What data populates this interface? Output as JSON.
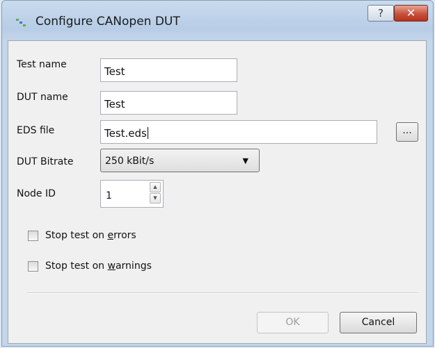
{
  "window": {
    "title": "Configure CANopen DUT",
    "help_label": "?",
    "close_label": "✕"
  },
  "form": {
    "test_name": {
      "label": "Test name",
      "value": "Test"
    },
    "dut_name": {
      "label": "DUT name",
      "value": "Test"
    },
    "eds_file": {
      "label": "EDS file",
      "value": "Test.eds",
      "browse_label": "..."
    },
    "dut_bitrate": {
      "label": "DUT Bitrate",
      "selected": "250 kBit/s"
    },
    "node_id": {
      "label": "Node ID",
      "value": "1"
    }
  },
  "options": {
    "stop_on_errors": {
      "label_prefix": "Stop test on ",
      "label_access": "e",
      "label_suffix": "rrors",
      "checked": false
    },
    "stop_on_warnings": {
      "label_prefix": "Stop test on ",
      "label_access": "w",
      "label_suffix": "arnings",
      "checked": false
    }
  },
  "buttons": {
    "ok": "OK",
    "cancel": "Cancel"
  },
  "icons": {
    "app": "app-icon",
    "help": "help-icon",
    "close": "close-icon",
    "combo_arrow": "dropdown-arrow-icon",
    "spin_up": "spin-up-icon",
    "spin_down": "spin-down-icon"
  }
}
